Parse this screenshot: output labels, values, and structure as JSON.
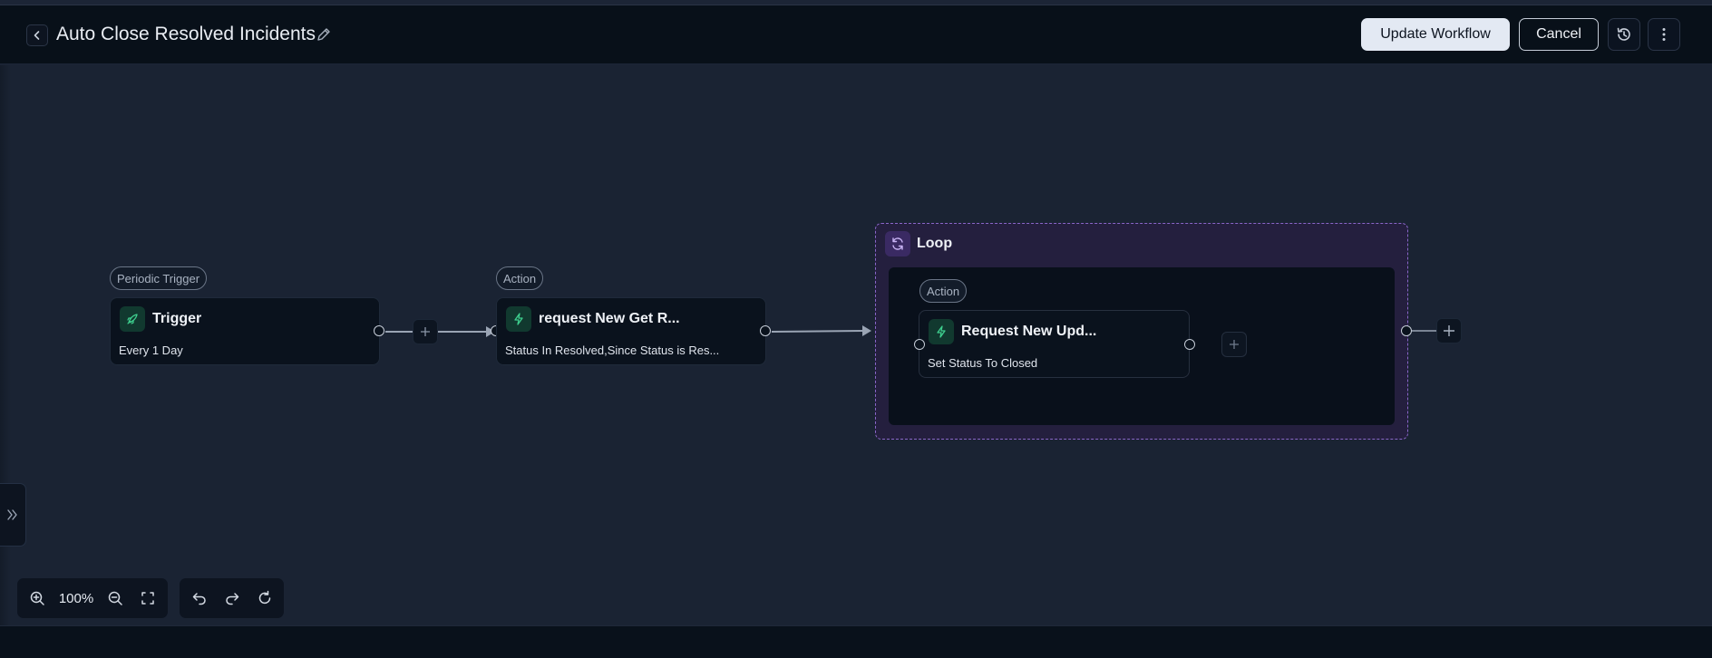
{
  "header": {
    "title": "Auto Close Resolved Incidents",
    "update_label": "Update Workflow",
    "cancel_label": "Cancel"
  },
  "nodes": {
    "trigger": {
      "tag": "Periodic Trigger",
      "title": "Trigger",
      "subtitle": "Every 1 Day",
      "icon": "rocket-icon"
    },
    "get_action": {
      "tag": "Action",
      "title": "request New Get R...",
      "subtitle": "Status In Resolved,Since Status is Res...",
      "icon": "lightning-icon"
    },
    "loop": {
      "title": "Loop",
      "icon": "refresh-icon",
      "inner_action": {
        "tag": "Action",
        "title": "Request New Upd...",
        "subtitle": "Set Status To Closed",
        "icon": "lightning-icon"
      }
    }
  },
  "toolbar": {
    "zoom_level": "100%"
  },
  "colors": {
    "canvas": "#1a2333",
    "header": "#081019",
    "node": "#0a121d",
    "loop_border": "#8a66c9",
    "action_icon_bg": "#11392f",
    "action_icon": "#3ecf8e"
  }
}
